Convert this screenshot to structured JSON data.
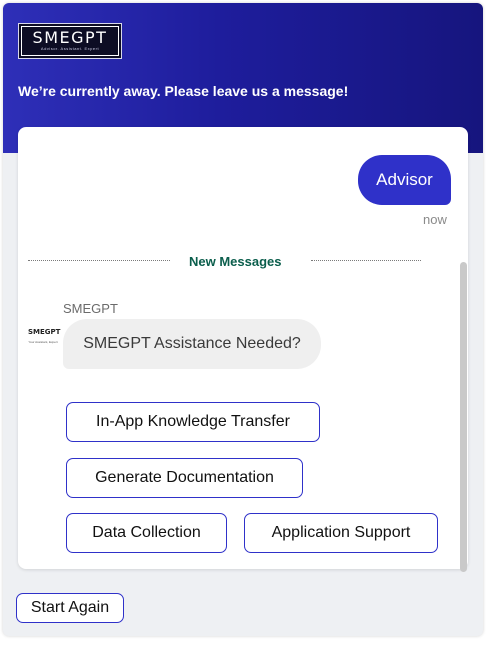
{
  "header": {
    "logo_text": "SMEGPT",
    "logo_tagline": "Advisor. Assistant. Expert",
    "away_message": "We’re currently away. Please leave us a message!"
  },
  "conversation": {
    "user_message": "Advisor",
    "user_timestamp": "now",
    "divider_label": "New Messages",
    "bot_name": "SMEGPT",
    "bot_avatar_text": "SMEGPT",
    "bot_avatar_tagline": "Your Assistant, Expert",
    "bot_message": "SMEGPT Assistance Needed?",
    "options": [
      "In-App Knowledge Transfer",
      "Generate Documentation",
      "Data Collection",
      "Application Support"
    ]
  },
  "footer": {
    "start_again_label": "Start Again"
  },
  "colors": {
    "header_gradient_start": "#2e2fb8",
    "header_gradient_end": "#16157e",
    "accent": "#2f31c9",
    "divider_text": "#0b5e4c",
    "bot_bubble": "#efefef"
  }
}
